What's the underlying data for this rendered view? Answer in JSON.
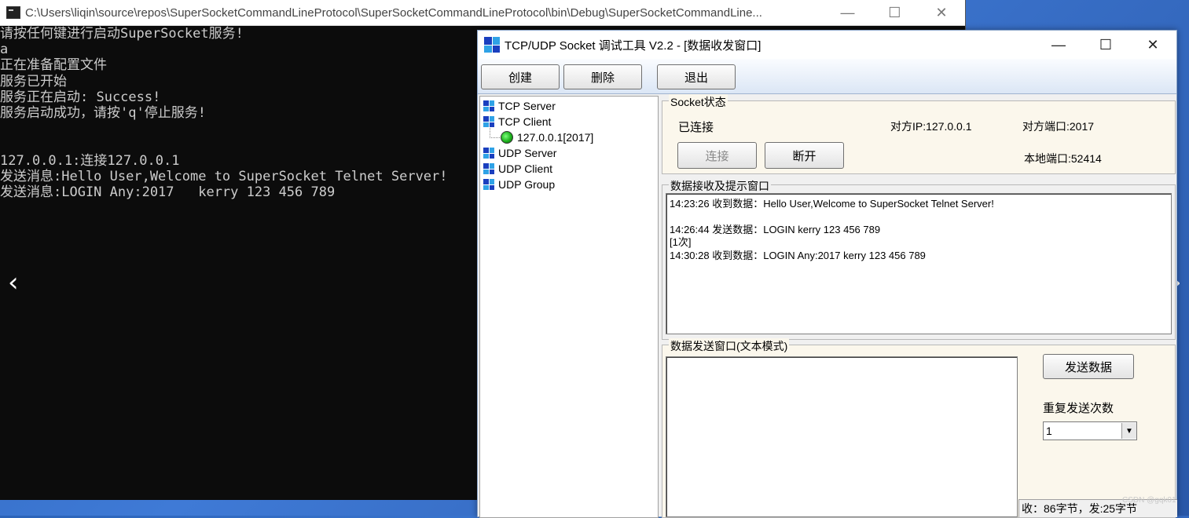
{
  "console": {
    "title": "C:\\Users\\liqin\\source\\repos\\SuperSocketCommandLineProtocol\\SuperSocketCommandLineProtocol\\bin\\Debug\\SuperSocketCommandLine...",
    "lines": [
      "请按任何键进行启动SuperSocket服务!",
      "a",
      "正在准备配置文件",
      "服务已开始",
      "服务正在启动: Success!",
      "服务启动成功，请按'q'停止服务!",
      "",
      "",
      "127.0.0.1:连接127.0.0.1",
      "发送消息:Hello User,Welcome to SuperSocket Telnet Server!",
      "发送消息:LOGIN Any:2017   kerry 123 456 789"
    ],
    "minimize": "—",
    "maximize": "☐",
    "close": "✕"
  },
  "nav": {
    "prev": "‹",
    "next": "›"
  },
  "tool": {
    "title": "TCP/UDP Socket 调试工具 V2.2 - [数据收发窗口]",
    "minimize": "—",
    "maximize": "☐",
    "close": "✕",
    "toolbar": {
      "create": "创建",
      "delete": "删除",
      "exit": "退出"
    },
    "tree": {
      "tcp_server": "TCP Server",
      "tcp_client": "TCP Client",
      "client_conn": "127.0.0.1[2017]",
      "udp_server": "UDP Server",
      "udp_client": "UDP Client",
      "udp_group": "UDP Group"
    },
    "socket_status": {
      "group_label": "Socket状态",
      "state": "已连接",
      "remote_ip": "对方IP:127.0.0.1",
      "remote_port": "对方端口:2017",
      "local_port": "本地端口:52414",
      "connect_btn": "连接",
      "disconnect_btn": "断开"
    },
    "receive": {
      "group_label": "数据接收及提示窗口",
      "lines": [
        "14:23:26 收到数据：Hello User,Welcome to SuperSocket Telnet Server!",
        "14:26:44 发送数据：LOGIN kerry 123 456 789",
        "[1次]",
        "14:30:28 收到数据：LOGIN Any:2017   kerry 123 456 789"
      ]
    },
    "send": {
      "group_label": "数据发送窗口(文本模式)",
      "text": "",
      "send_btn": "发送数据",
      "repeat_label": "重复发送次数",
      "repeat_value": "1"
    },
    "status_bar": "收：86字节，发:25字节"
  },
  "watermark": "CSDN @gqk01"
}
